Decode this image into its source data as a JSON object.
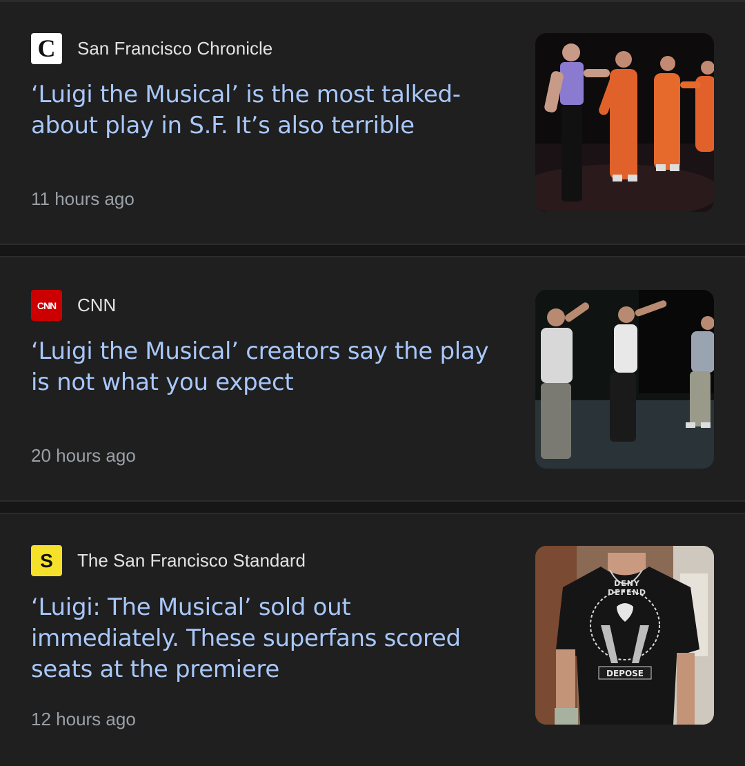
{
  "articles": [
    {
      "source": "San Francisco Chronicle",
      "source_logo_text": "C",
      "headline": "‘Luigi the Musical’ is the most talked-about play in S.F. It’s also terrible",
      "time": "11 hours ago",
      "image": "stage-performers-orange-jumpsuits"
    },
    {
      "source": "CNN",
      "source_logo_text": "CNN",
      "headline": "‘Luigi the Musical’ creators say the play is not what you expect",
      "time": "20 hours ago",
      "image": "stage-performers-pointing"
    },
    {
      "source": "The San Francisco Standard",
      "source_logo_text": "S",
      "headline": "‘Luigi: The Musical’ sold out immediately. These superfans scored seats at the premiere",
      "time": "12 hours ago",
      "image": "fan-in-graphic-tshirt",
      "shirt_text": [
        "DENY",
        "DEFEND",
        "DEPOSE"
      ]
    }
  ],
  "colors": {
    "background": "#1f1f1f",
    "headline": "#a8c7fa",
    "source": "#e3e3e3",
    "timestamp": "#9aa0a6",
    "cnn_red": "#cc0000",
    "standard_yellow": "#f6e12a"
  }
}
